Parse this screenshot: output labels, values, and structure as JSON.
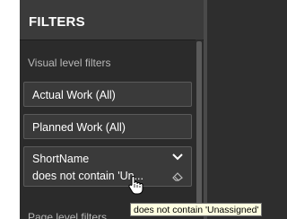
{
  "filters_pane": {
    "title": "FILTERS",
    "visual_level_label": "Visual level filters",
    "page_level_label": "Page level filters"
  },
  "filter_cards": [
    {
      "label": "Actual Work (All)"
    },
    {
      "label": "Planned Work (All)"
    },
    {
      "field": "ShortName",
      "condition": "does not contain 'Un..."
    }
  ],
  "tooltip": {
    "text": "does not contain 'Unassigned'"
  },
  "icons": {
    "expand": "chevron-down-icon",
    "clear": "eraser-icon",
    "cursor": "hand-pointer-icon"
  },
  "colors": {
    "pane_background": "#2b2b2b",
    "pane_header": "#3b3b3b",
    "card_background": "#3a3a3a",
    "card_border": "#5a5a5a",
    "tooltip_background": "#ffffe1"
  }
}
